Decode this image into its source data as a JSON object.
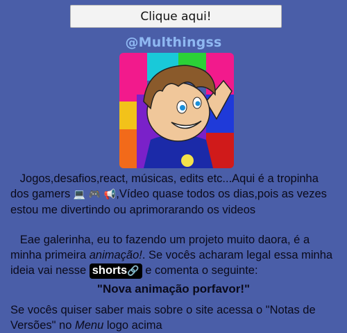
{
  "header": {
    "button_label": "Clique aqui!",
    "handle": "@Multhingss"
  },
  "profile": {
    "avatar_alt": "avatar"
  },
  "bio": {
    "line1_text": "Jogos,desafios,react, músicas, edits etc...Aqui é a tropinha dos gamers ",
    "emojis": [
      "💻",
      "🎮",
      "📢"
    ],
    "line1_rest": ",Vídeo quase todos os dias,pois as vezes estou me divertindo ou aprimorarando os videos"
  },
  "announcement": {
    "text_a": "Eae galerinha, eu to fazendo um projeto muito daora, é a minha primeira ",
    "italic_word": "animação!",
    "text_b": ". Se vocês acharam legal essa minha ideia vai nesse ",
    "link_label": "shorts",
    "link_icon": "🔗",
    "text_c": " e comenta o seguinte:",
    "quote": "\"Nova animação porfavor!\""
  },
  "footer_note": {
    "text_a": "Se vocês quiser saber mais sobre o site acessa o \"Notas de Versões\" no ",
    "italic_word": "Menu",
    "text_b": " logo acima"
  },
  "colors": {
    "background": "#4a5ea8",
    "handle": "#8fb8f2"
  }
}
